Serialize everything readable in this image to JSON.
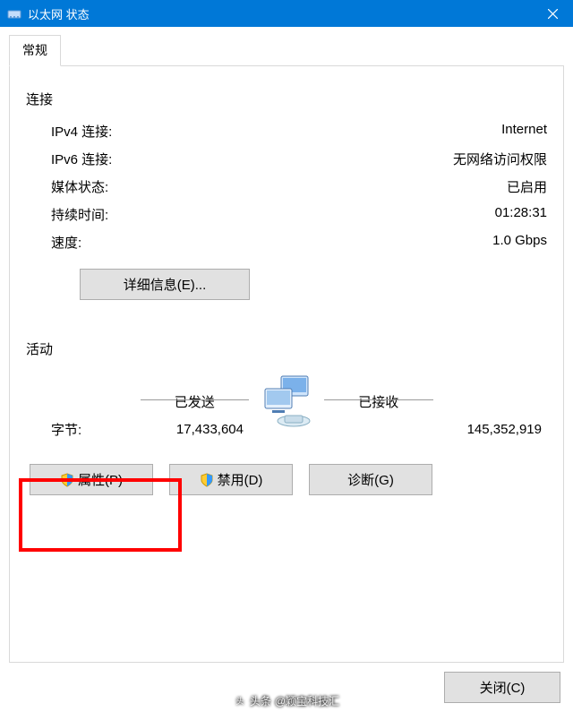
{
  "window": {
    "title": "以太网 状态"
  },
  "tabs": {
    "general": "常规"
  },
  "connection": {
    "title": "连接",
    "rows": {
      "ipv4_label": "IPv4 连接:",
      "ipv4_value": "Internet",
      "ipv6_label": "IPv6 连接:",
      "ipv6_value": "无网络访问权限",
      "media_label": "媒体状态:",
      "media_value": "已启用",
      "duration_label": "持续时间:",
      "duration_value": "01:28:31",
      "speed_label": "速度:",
      "speed_value": "1.0 Gbps"
    },
    "details_button": "详细信息(E)..."
  },
  "activity": {
    "title": "活动",
    "sent_label": "已发送",
    "received_label": "已接收",
    "bytes_label": "字节:",
    "bytes_sent": "17,433,604",
    "bytes_received": "145,352,919"
  },
  "buttons": {
    "properties": "属性(P)",
    "disable": "禁用(D)",
    "diagnose": "诊断(G)",
    "close": "关闭(C)"
  },
  "watermark": {
    "prefix": "头条",
    "account": "@颖宝科技汇"
  }
}
